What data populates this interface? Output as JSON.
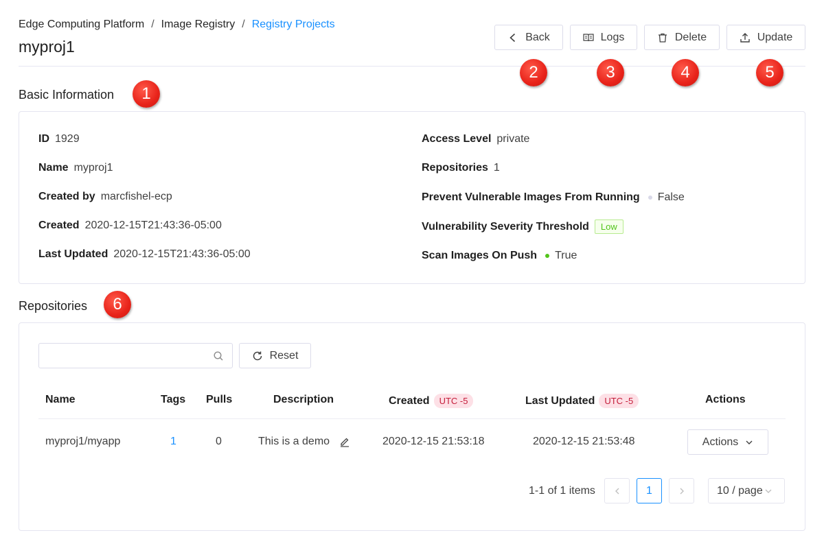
{
  "breadcrumb": {
    "items": [
      "Edge Computing Platform",
      "Image Registry",
      "Registry Projects"
    ],
    "separator": "/"
  },
  "page_title": "myproj1",
  "toolbar": {
    "back_label": "Back",
    "logs_label": "Logs",
    "delete_label": "Delete",
    "update_label": "Update"
  },
  "callouts": [
    "1",
    "2",
    "3",
    "4",
    "5",
    "6"
  ],
  "basic_info": {
    "title": "Basic Information",
    "left": [
      {
        "key": "ID",
        "value": "1929"
      },
      {
        "key": "Name",
        "value": "myproj1"
      },
      {
        "key": "Created by",
        "value": "marcfishel-ecp"
      },
      {
        "key": "Created",
        "value": "2020-12-15T21:43:36-05:00"
      },
      {
        "key": "Last Updated",
        "value": "2020-12-15T21:43:36-05:00"
      }
    ],
    "right": [
      {
        "key": "Access Level",
        "value": "private"
      },
      {
        "key": "Repositories",
        "value": "1"
      },
      {
        "key": "Prevent Vulnerable Images From Running",
        "value": "False"
      },
      {
        "key": "Vulnerability Severity Threshold",
        "value": "Low"
      },
      {
        "key": "Scan Images On Push",
        "value": "True"
      }
    ]
  },
  "repositories": {
    "title": "Repositories",
    "search_placeholder": "",
    "reset_label": "Reset",
    "columns": {
      "name": "Name",
      "tags": "Tags",
      "pulls": "Pulls",
      "description": "Description",
      "created": "Created",
      "last_updated": "Last Updated",
      "actions": "Actions",
      "tz_badge": "UTC -5"
    },
    "rows": [
      {
        "name": "myproj1/myapp",
        "tags": "1",
        "pulls": "0",
        "description": "This is a demo",
        "created": "2020-12-15 21:53:18",
        "last_updated": "2020-12-15 21:53:48",
        "actions_label": "Actions"
      }
    ],
    "pagination": {
      "summary": "1-1 of 1 items",
      "current_page": "1",
      "page_size": "10 / page"
    }
  },
  "colors": {
    "link": "#1890ff",
    "callout": "#e8231a",
    "status_false": "#d9d9e8",
    "status_true": "#52c41a",
    "tag_low": "#52c41a",
    "utc_badge_bg": "#fde0e6"
  }
}
